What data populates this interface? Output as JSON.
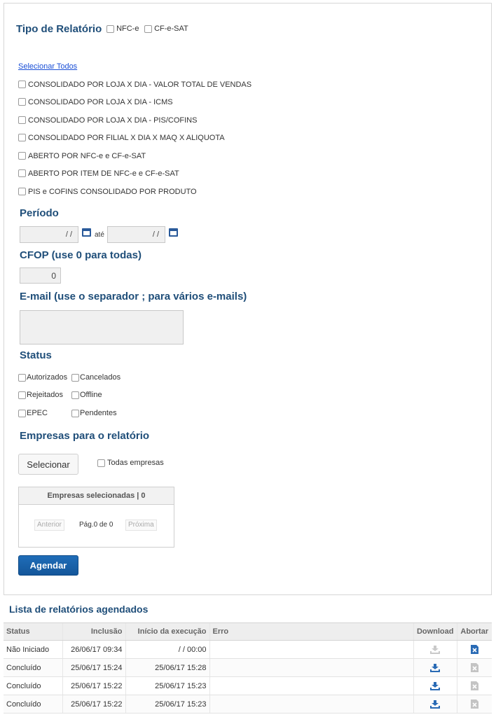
{
  "tipo": {
    "title": "Tipo de Relatório",
    "options": [
      "NFC-e",
      "CF-e-SAT"
    ]
  },
  "select_all": "Selecionar Todos",
  "reports": [
    "CONSOLIDADO POR LOJA X DIA - VALOR TOTAL DE VENDAS",
    "CONSOLIDADO POR LOJA X DIA - ICMS",
    "CONSOLIDADO POR LOJA X DIA - PIS/COFINS",
    "CONSOLIDADO POR FILIAL X DIA X MAQ X ALIQUOTA",
    "ABERTO POR NFC-e e CF-e-SAT",
    "ABERTO POR ITEM DE NFC-e e CF-e-SAT",
    "PIS e COFINS CONSOLIDADO POR PRODUTO"
  ],
  "periodo": {
    "title": "Período",
    "start_value": "/ /",
    "end_value": "/ /",
    "ate": "até"
  },
  "cfop": {
    "title": "CFOP (use 0 para todas)",
    "value": "0"
  },
  "email": {
    "title": "E-mail (use o separador ; para vários e-mails)",
    "value": ""
  },
  "status": {
    "title": "Status",
    "options": [
      "Autorizados",
      "Cancelados",
      "Rejeitados",
      "Offline",
      "EPEC",
      "Pendentes"
    ]
  },
  "empresas": {
    "title": "Empresas para o relatório",
    "select_button": "Selecionar",
    "all_label": "Todas empresas",
    "selected_header": "Empresas selecionadas | 0",
    "prev": "Anterior",
    "page": "Pág.0 de 0",
    "next": "Próxima"
  },
  "agendar": "Agendar",
  "list": {
    "title": "Lista de relatórios agendados",
    "columns": [
      "Status",
      "Inclusão",
      "Início da execução",
      "Erro",
      "Download",
      "Abortar"
    ],
    "rows": [
      {
        "status": "Não Iniciado",
        "inclusao": "26/06/17 09:34",
        "inicio": "/ / 00:00",
        "erro": "",
        "download_active": false,
        "abort_active": true
      },
      {
        "status": "Concluído",
        "inclusao": "25/06/17 15:24",
        "inicio": "25/06/17 15:28",
        "erro": "",
        "download_active": true,
        "abort_active": false
      },
      {
        "status": "Concluído",
        "inclusao": "25/06/17 15:22",
        "inicio": "25/06/17 15:23",
        "erro": "",
        "download_active": true,
        "abort_active": false
      },
      {
        "status": "Concluído",
        "inclusao": "25/06/17 15:22",
        "inicio": "25/06/17 15:23",
        "erro": "",
        "download_active": true,
        "abort_active": false
      }
    ]
  },
  "colors": {
    "heading": "#1f4e79",
    "primary_button": "#1a63ad",
    "icon_blue": "#2a6bb5",
    "icon_gray": "#bdbdbd"
  }
}
